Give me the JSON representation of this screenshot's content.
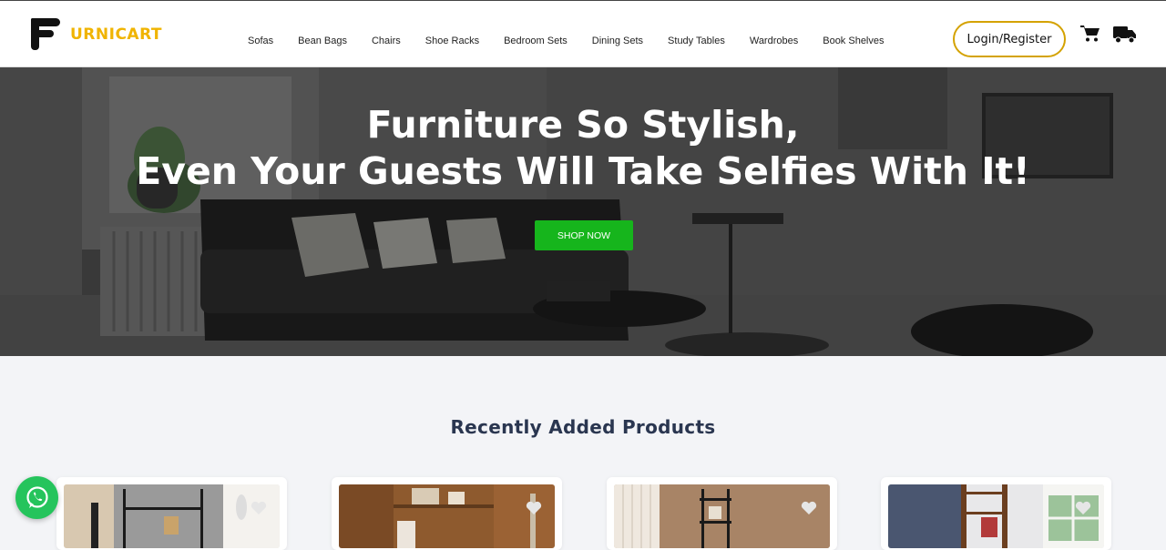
{
  "brand": {
    "logo_text": "URNICART",
    "accent": "#f0b400"
  },
  "nav": [
    "Sofas",
    "Bean Bags",
    "Chairs",
    "Shoe Racks",
    "Bedroom Sets",
    "Dining Sets",
    "Study Tables",
    "Wardrobes",
    "Book Shelves"
  ],
  "header": {
    "login_label": "Login/Register",
    "icons": [
      "cart-icon",
      "truck-icon"
    ]
  },
  "hero": {
    "title_line1": "Furniture So Stylish,",
    "title_line2": "Even Your Guests Will Take Selfies With It!",
    "cta_label": "SHOP NOW",
    "cta_color": "#16b51c"
  },
  "products": {
    "title": "Recently Added Products",
    "cards": [
      {
        "image": "bookshelf-black-image"
      },
      {
        "image": "bookshelf-wood-image"
      },
      {
        "image": "corner-shelf-image"
      },
      {
        "image": "ladder-shelf-image"
      }
    ]
  },
  "whatsapp": {
    "icon": "whatsapp-icon",
    "color": "#25c45c"
  }
}
